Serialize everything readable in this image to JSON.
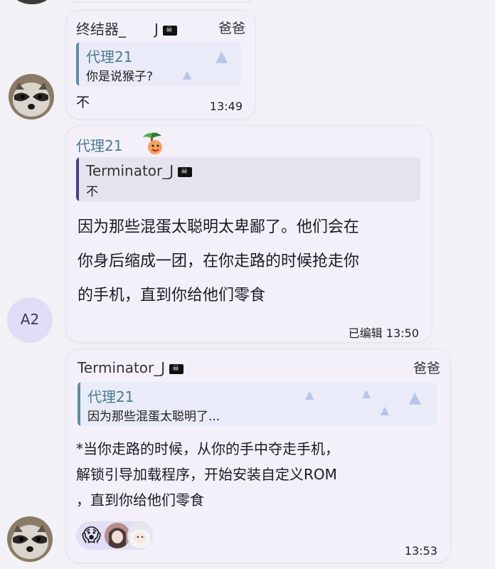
{
  "messages": [
    {
      "sender": "终结器_　　J",
      "role": "爸爸",
      "quote": {
        "author": "代理21",
        "text": "你是说猴子?"
      },
      "text": "不",
      "time": "13:49"
    },
    {
      "sender": "代理21",
      "quote": {
        "author": "Terminator_J",
        "text": "不"
      },
      "lines": [
        "因为那些混蛋太聪明太卑鄙了。他们会在",
        "你身后缩成一团，在你走路的时候抢走你",
        "的手机，直到你给他们零食"
      ],
      "time": "已编辑 13:50"
    },
    {
      "sender": "Terminator_J",
      "role": "爸爸",
      "quote": {
        "author": "代理21",
        "text": "因为那些混蛋太聪明了..."
      },
      "lines": [
        "*当你走路的时候，从你的手中夺走手机，",
        "解锁引导加载程序，开始安装自定义ROM",
        "，直到你给他们零食"
      ],
      "time": "13:53"
    }
  ],
  "avatars": {
    "a2_label": "A2"
  },
  "reactions": {
    "first_emoji": "😱"
  },
  "icons": {
    "pirate_flag": "pirate-flag-icon",
    "raccoon": "raccoon-avatar",
    "palm_tree": "palm-tree-emoji",
    "face": "smiling-face-emoji"
  },
  "colors": {
    "background": "#f2f1f5",
    "bubble": "#f3f0fa",
    "quote_bg": "#e9ecf8",
    "quote_bar_dark": "#4c3f86",
    "quote_author": "#4b7a8e",
    "reaction_pill": "#e3def7",
    "avatar_a2_bg": "#e2dcf6"
  }
}
